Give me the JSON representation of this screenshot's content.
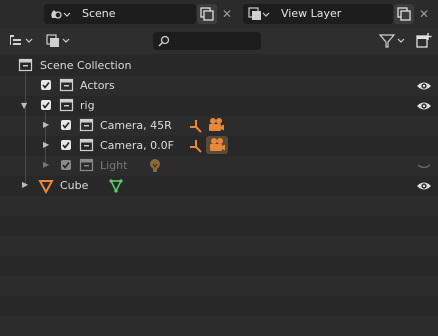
{
  "header": {
    "scene_label": "Scene",
    "view_layer_label": "View Layer"
  },
  "toolbar": {
    "search_placeholder": ""
  },
  "outliner": {
    "scene_collection": "Scene Collection",
    "items": [
      {
        "label": "Actors"
      },
      {
        "label": "rig"
      },
      {
        "label": "Camera, 45R"
      },
      {
        "label": "Camera, 0.0F"
      },
      {
        "label": "Light"
      },
      {
        "label": "Cube"
      }
    ]
  },
  "colors": {
    "accent_orange": "#e7883a",
    "mesh_green": "#5fd16a",
    "light_icon": "#8a6a3a",
    "background": "#282828"
  }
}
